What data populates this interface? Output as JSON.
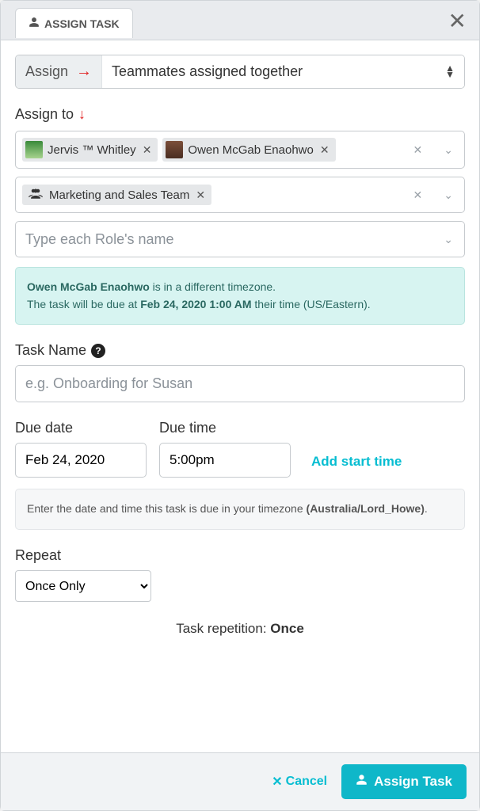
{
  "header": {
    "tab_label": "ASSIGN TASK"
  },
  "assign_mode": {
    "label": "Assign",
    "value": "Teammates assigned together"
  },
  "assign_to": {
    "label": "Assign to",
    "users": [
      {
        "name": "Jervis ™ Whitley"
      },
      {
        "name": "Owen McGab Enaohwo"
      }
    ],
    "groups": [
      {
        "name": "Marketing and Sales Team"
      }
    ],
    "role_placeholder": "Type each Role's name"
  },
  "tz_notice": {
    "person": "Owen McGab Enaohwo",
    "line1_suffix": " is in a different timezone.",
    "line2_prefix": "The task will be due at ",
    "due_text": "Feb 24, 2020 1:00 AM",
    "line2_suffix": " their time (US/Eastern)."
  },
  "task_name": {
    "label": "Task Name",
    "placeholder": "e.g. Onboarding for Susan"
  },
  "due": {
    "date_label": "Due date",
    "time_label": "Due time",
    "date_value": "Feb 24, 2020",
    "time_value": "5:00pm",
    "add_start": "Add start time"
  },
  "tz_local_note": {
    "prefix": "Enter the date and time this task is due in your timezone ",
    "tz": "(Australia/Lord_Howe)",
    "suffix": "."
  },
  "repeat": {
    "label": "Repeat",
    "value": "Once Only",
    "repetition_label": "Task repetition: ",
    "repetition_value": "Once"
  },
  "footer": {
    "cancel": "Cancel",
    "assign": "Assign Task"
  }
}
